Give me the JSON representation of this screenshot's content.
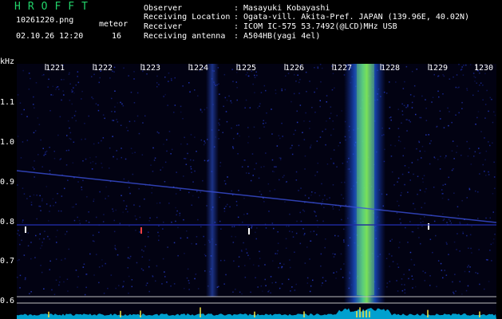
{
  "header": {
    "title": "HROFFT",
    "filename": "10261220.png",
    "datetime": "02.10.26 12:20",
    "meteor_label": "meteor",
    "meteor_count": "16"
  },
  "info": [
    {
      "key": "Observer",
      "value": ": Masayuki Kobayashi"
    },
    {
      "key": "Receiving Location",
      "value": ": Ogata-vill. Akita-Pref. JAPAN (139.96E, 40.02N)"
    },
    {
      "key": "Receiver",
      "value": ": ICOM IC-575 53.7492(@LCD)MHz USB"
    },
    {
      "key": "Receiving antenna",
      "value": ": A504HB(yagi 4el)"
    }
  ],
  "axes": {
    "y_unit": "kHz",
    "y_ticks": [
      "1.1",
      "1.0",
      "0.9",
      "0.8",
      "0.7",
      "0.6"
    ],
    "x_ticks": [
      "1221",
      "1222",
      "1223",
      "1224",
      "1225",
      "1226",
      "1227",
      "1228",
      "1229",
      "1230"
    ]
  },
  "colors": {
    "title": "#22d36a",
    "background": "#020212",
    "noise": "#1a2aa0",
    "echo_core": "#7de85a",
    "baseline": "#00c8ff"
  }
}
